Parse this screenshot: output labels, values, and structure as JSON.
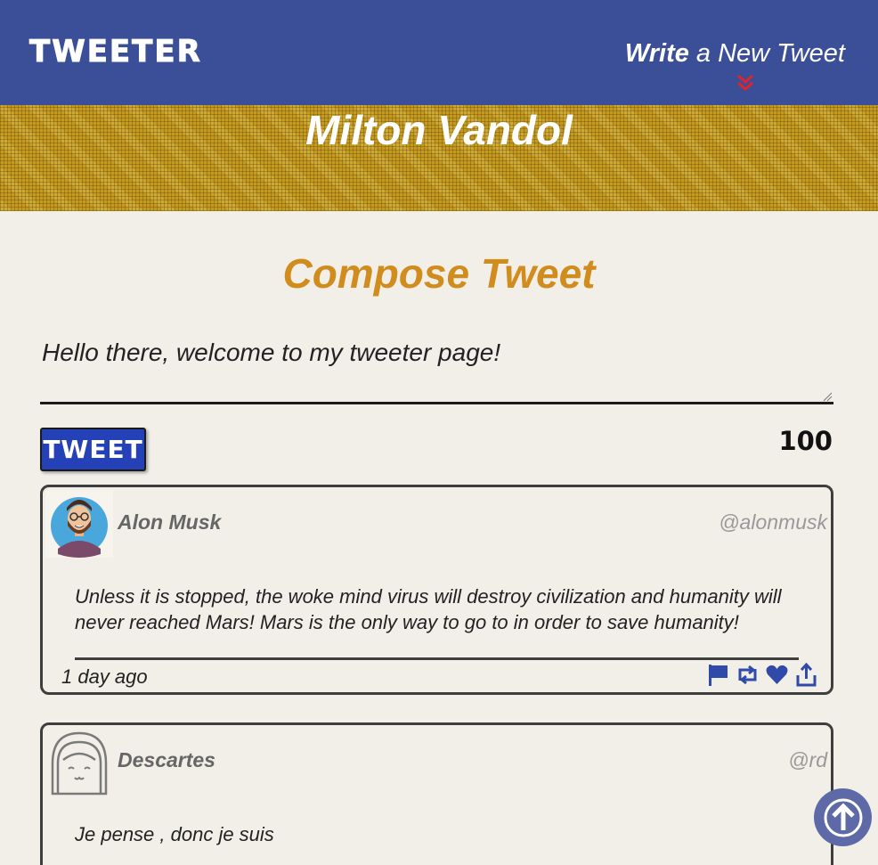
{
  "nav": {
    "logo": "TWEETER",
    "write_strong": "Write",
    "write_rest": " a New Tweet"
  },
  "profile": {
    "name": "Milton Vandol"
  },
  "compose": {
    "title": "Compose Tweet",
    "value": "Hello there, welcome to my tweeter page!",
    "button_label": "TWEET",
    "counter": "100"
  },
  "tweets": [
    {
      "name": "Alon Musk",
      "handle": "@alonmusk",
      "text": "Unless it is stopped, the woke mind virus will destroy civilization and humanity will never reached Mars! Mars is the only way to go to in order to save humanity!",
      "time": "1 day ago",
      "actions": [
        "flag-icon",
        "retweet-icon",
        "heart-icon",
        "share-icon"
      ]
    },
    {
      "name": "Descartes",
      "handle": "@rd",
      "text": "Je pense , donc je suis"
    }
  ],
  "colors": {
    "nav_bg": "#3a4f98",
    "banner": "#c69a1f",
    "compose_title": "#d18c1e",
    "button": "#2541b8",
    "action_icon": "#2f4aa8",
    "chevron": "#e0242a"
  }
}
